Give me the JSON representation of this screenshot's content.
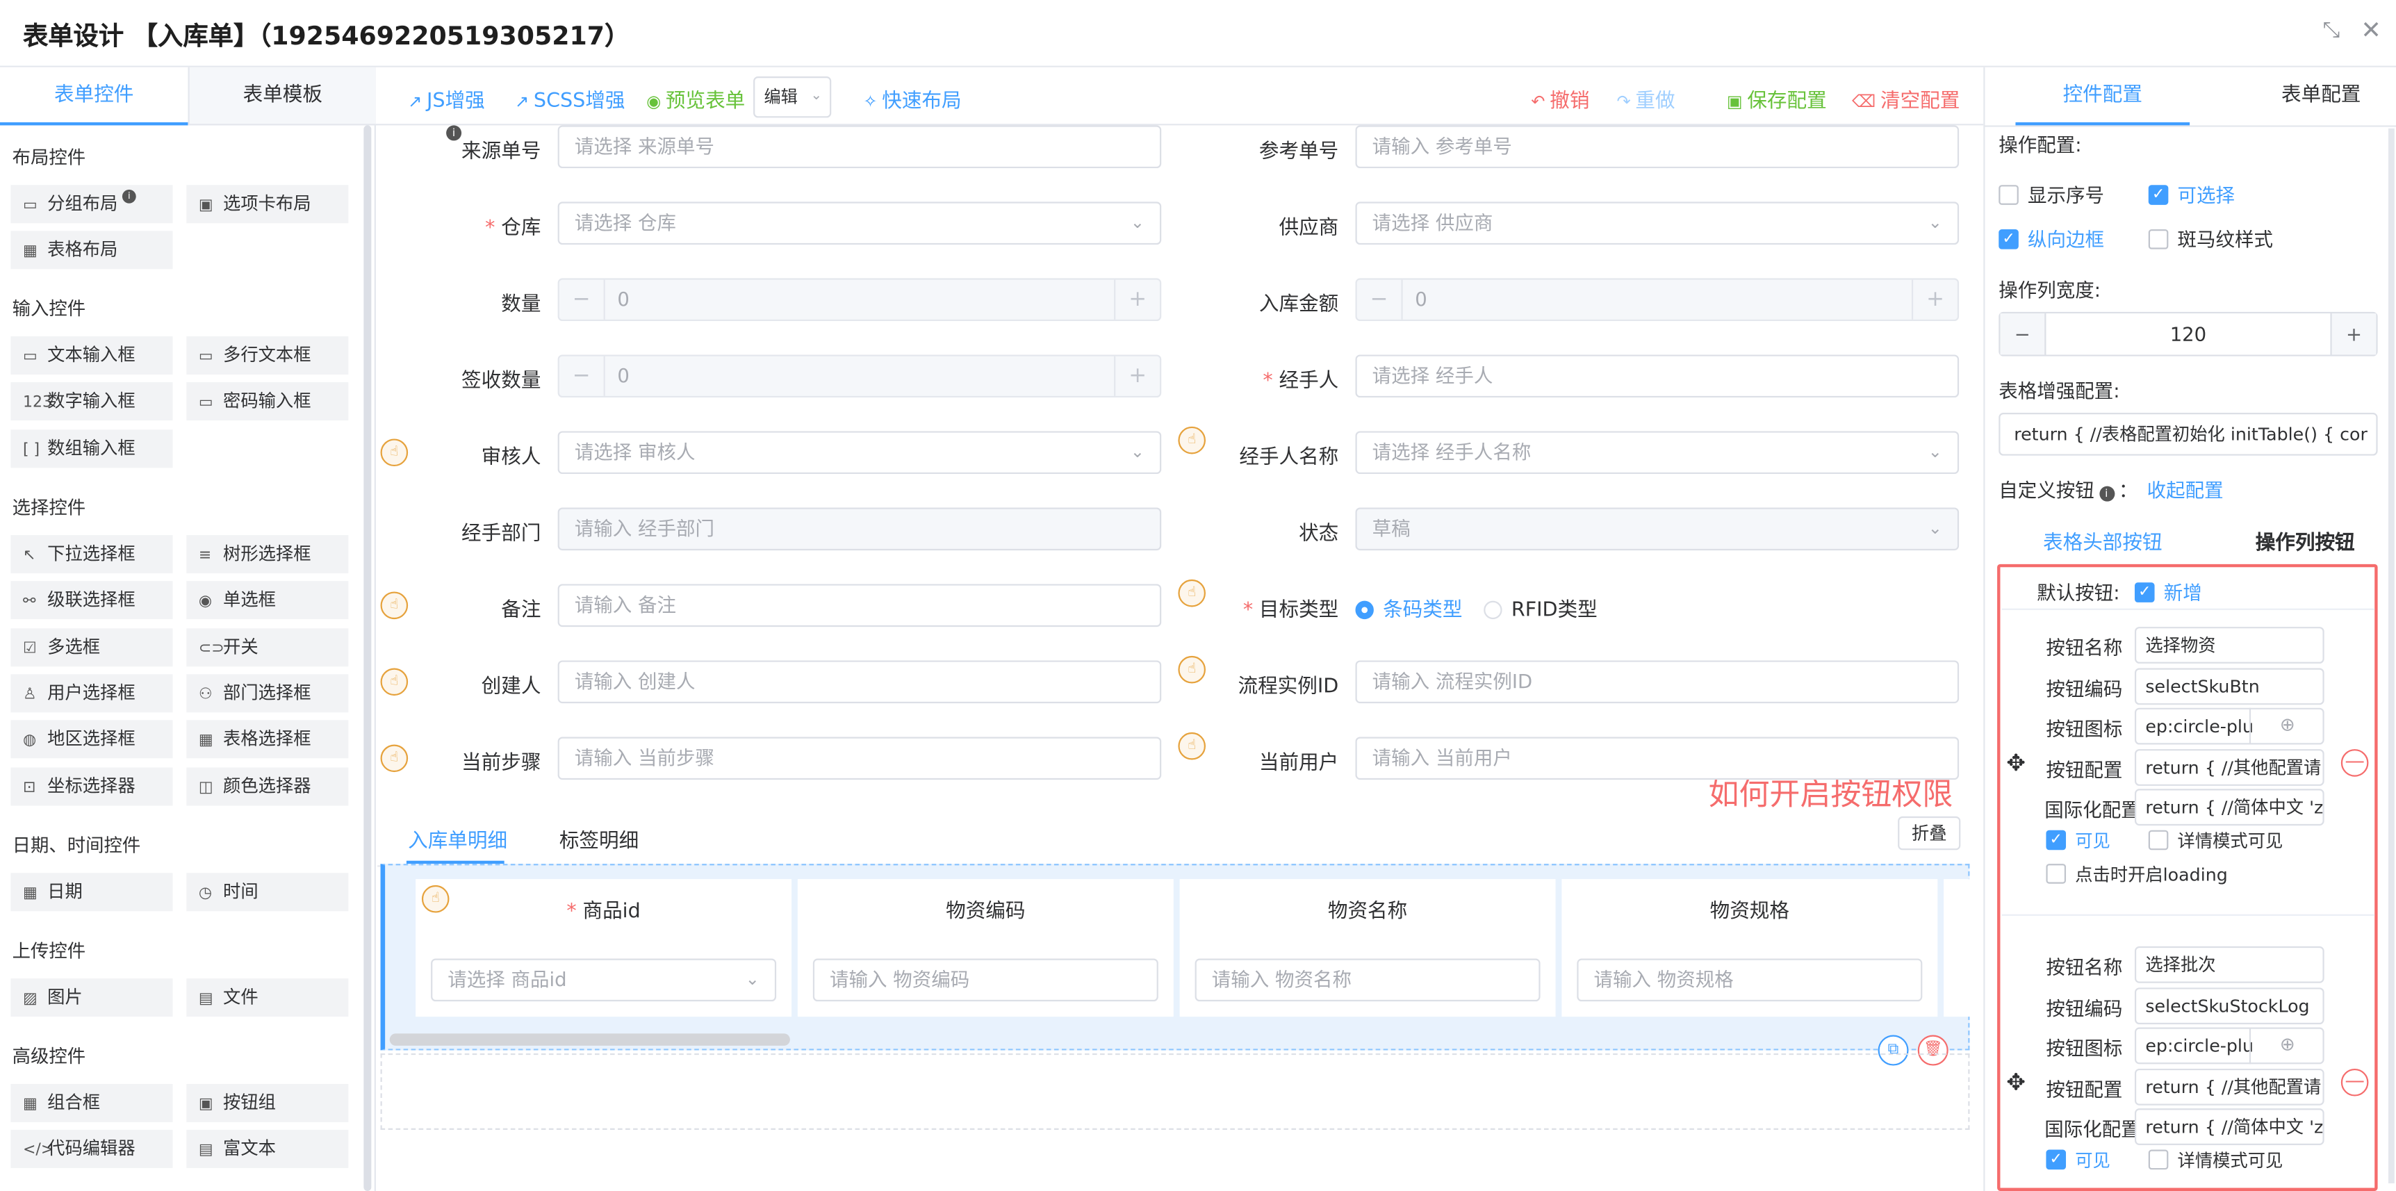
{
  "window": {
    "title": "表单设计 【入库单】（1925469220519305217）",
    "minimize_icon": "compress-icon",
    "close_icon": "close-icon"
  },
  "left_panel": {
    "tabs": [
      "表单控件",
      "表单模板"
    ],
    "groups": [
      {
        "title": "布局控件",
        "items": [
          "分组布局",
          "选项卡布局",
          "表格布局"
        ]
      },
      {
        "title": "输入控件",
        "items": [
          "文本输入框",
          "多行文本框",
          "数字输入框",
          "密码输入框",
          "数组输入框"
        ]
      },
      {
        "title": "选择控件",
        "items": [
          "下拉选择框",
          "树形选择框",
          "级联选择框",
          "单选框",
          "多选框",
          "开关",
          "用户选择框",
          "部门选择框",
          "地区选择框",
          "表格选择框",
          "坐标选择器",
          "颜色选择器"
        ]
      },
      {
        "title": "日期、时间控件",
        "items": [
          "日期",
          "时间"
        ]
      },
      {
        "title": "上传控件",
        "items": [
          "图片",
          "文件"
        ]
      },
      {
        "title": "高级控件",
        "items": [
          "组合框",
          "按钮组",
          "代码编辑器",
          "富文本"
        ]
      }
    ]
  },
  "toolbar": {
    "js": "JS增强",
    "scss": "SCSS增强",
    "preview": "预览表单",
    "mode": "编辑",
    "layout": "快速布局",
    "undo": "撤销",
    "redo": "重做",
    "save": "保存配置",
    "clear": "清空配置"
  },
  "form": {
    "fields": [
      {
        "label": "来源单号",
        "placeholder": "请选择 来源单号"
      },
      {
        "label": "参考单号",
        "placeholder": "请输入 参考单号"
      },
      {
        "label": "仓库",
        "placeholder": "请选择 仓库",
        "required": true
      },
      {
        "label": "供应商",
        "placeholder": "请选择 供应商"
      },
      {
        "label": "数量",
        "value": "0"
      },
      {
        "label": "入库金额",
        "value": "0"
      },
      {
        "label": "签收数量",
        "value": "0"
      },
      {
        "label": "经手人",
        "placeholder": "请选择 经手人",
        "required": true
      },
      {
        "label": "审核人",
        "placeholder": "请选择 审核人"
      },
      {
        "label": "经手人名称",
        "placeholder": "请选择 经手人名称"
      },
      {
        "label": "经手部门",
        "placeholder": "请输入 经手部门"
      },
      {
        "label": "状态",
        "value": "草稿"
      },
      {
        "label": "备注",
        "placeholder": "请输入 备注"
      },
      {
        "label": "目标类型",
        "required": true,
        "options": [
          "条码类型",
          "RFID类型"
        ]
      },
      {
        "label": "创建人",
        "placeholder": "请输入 创建人"
      },
      {
        "label": "流程实例ID",
        "placeholder": "请输入 流程实例ID"
      },
      {
        "label": "当前步骤",
        "placeholder": "请输入 当前步骤"
      },
      {
        "label": "当前用户",
        "placeholder": "请输入 当前用户"
      }
    ],
    "tabs": [
      "入库单明细",
      "标签明细"
    ],
    "collapse": "折叠",
    "table_columns": [
      {
        "header": "商品id",
        "required": true,
        "placeholder": "请选择 商品id"
      },
      {
        "header": "物资编码",
        "placeholder": "请输入 物资编码"
      },
      {
        "header": "物资名称",
        "placeholder": "请输入 物资名称"
      },
      {
        "header": "物资规格",
        "placeholder": "请输入 物资规格"
      }
    ]
  },
  "annotation": "如何开启按钮权限",
  "right_panel": {
    "tabs": [
      "控件配置",
      "表单配置"
    ],
    "op_config": "操作配置:",
    "show_index": "显示序号",
    "selectable": "可选择",
    "vertical_border": "纵向边框",
    "zebra": "斑马纹样式",
    "op_width_label": "操作列宽度:",
    "op_width": "120",
    "enhance_label": "表格增强配置:",
    "enhance_value": "return {  //表格配置初始化  initTable() {    cor",
    "custom_btn_label": "自定义按钮",
    "collapse_config": "收起配置",
    "sub_tabs": [
      "表格头部按钮",
      "操作列按钮"
    ],
    "default_btn_label": "默认按钮:",
    "default_btn": "新增",
    "buttons": [
      {
        "name": "选择物资",
        "code": "selectSkuBtn",
        "icon": "ep:circle-plu",
        "config": "return {  //其他配置请",
        "i18n": "return {  //简体中文  'z",
        "visible": "可见",
        "detail_visible": "详情模式可见",
        "loading": "点击时开启loading"
      },
      {
        "name": "选择批次",
        "code": "selectSkuStockLog",
        "icon": "ep:circle-plu",
        "config": "return {  //其他配置请",
        "i18n": "return {  //简体中文  'z",
        "visible": "可见",
        "detail_visible": "详情模式可见"
      }
    ],
    "field_labels": {
      "name": "按钮名称",
      "code": "按钮编码",
      "icon": "按钮图标",
      "config": "按钮配置",
      "i18n": "国际化配置"
    }
  },
  "colors": {
    "primary": "#409eff",
    "danger": "#f56c6c",
    "warning": "#e6a23c",
    "success": "#67c23a"
  }
}
